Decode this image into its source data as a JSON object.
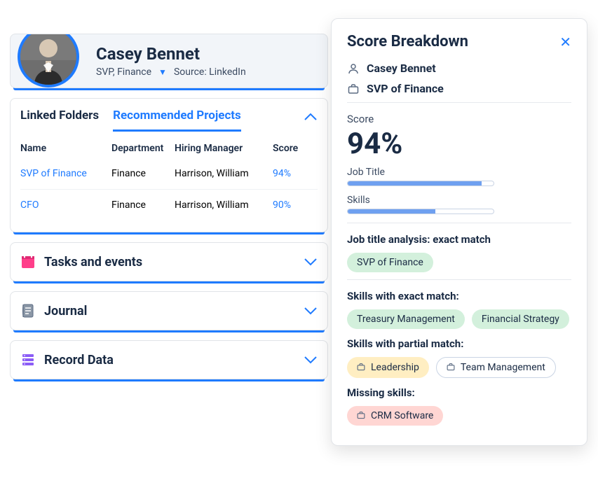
{
  "profile": {
    "name": "Casey Bennet",
    "title": "SVP, Finance",
    "source_label": "Source: LinkedIn"
  },
  "tabs": {
    "linked_folders": "Linked Folders",
    "recommended_projects": "Recommended Projects"
  },
  "projects": {
    "columns": {
      "name": "Name",
      "department": "Department",
      "manager": "Hiring Manager",
      "score": "Score"
    },
    "rows": [
      {
        "name": "SVP of Finance",
        "department": "Finance",
        "manager": "Harrison, William",
        "score": "94%"
      },
      {
        "name": "CFO",
        "department": "Finance",
        "manager": "Harrison, William",
        "score": "90%"
      }
    ]
  },
  "sections": {
    "tasks": "Tasks and events",
    "journal": "Journal",
    "record_data": "Record Data"
  },
  "breakdown": {
    "title": "Score Breakdown",
    "name": "Casey Bennet",
    "role": "SVP of Finance",
    "score_label": "Score",
    "score_value": "94%",
    "job_title_label": "Job Title",
    "job_title_progress": 92,
    "skills_label": "Skills",
    "skills_progress": 60,
    "job_title_analysis": "Job title analysis: exact match",
    "job_title_match": "SVP of Finance",
    "exact_heading": "Skills with exact match:",
    "exact_skills": [
      "Treasury Management",
      "Financial Strategy"
    ],
    "partial_heading": "Skills with partial match:",
    "partial_skills": [
      "Leadership",
      "Team Management"
    ],
    "missing_heading": "Missing skills:",
    "missing_skills": [
      "CRM Software"
    ]
  },
  "colors": {
    "accent": "#1f7bff"
  }
}
